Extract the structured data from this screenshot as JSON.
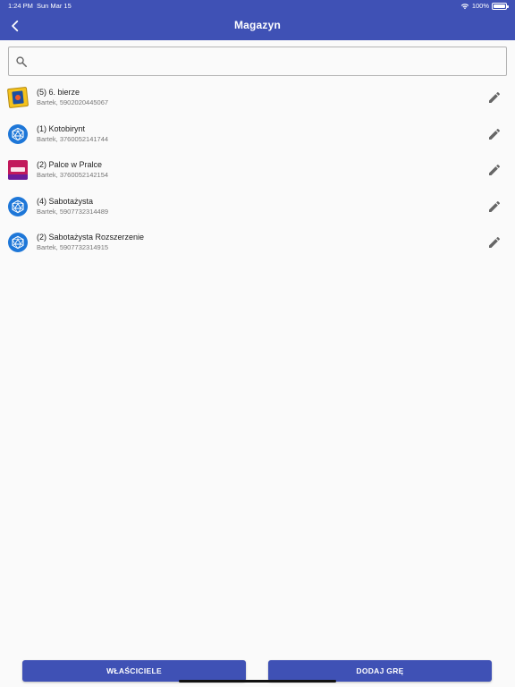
{
  "status_bar": {
    "time": "1:24 PM",
    "date": "Sun Mar 15",
    "battery": "100%",
    "battery_level": 1.0
  },
  "header": {
    "title": "Magazyn",
    "back_icon": "chevron-left-icon"
  },
  "search": {
    "value": "",
    "placeholder": "",
    "icon": "search-icon"
  },
  "games": [
    {
      "title": "(5) 6. bierze",
      "subtitle": "Bartek, 5902020445067",
      "thumb": "game-box-yellow"
    },
    {
      "title": "(1) Kotobirynt",
      "subtitle": "Bartek, 3760052141744",
      "thumb": "d20-dice-icon"
    },
    {
      "title": "(2) Palce w Pralce",
      "subtitle": "Bartek, 3760052142154",
      "thumb": "game-box-pink"
    },
    {
      "title": "(4) Sabotażysta",
      "subtitle": "Bartek, 5907732314489",
      "thumb": "d20-dice-icon"
    },
    {
      "title": "(2) Sabotażysta Rozszerzenie",
      "subtitle": "Bartek, 5907732314915",
      "thumb": "d20-dice-icon"
    }
  ],
  "buttons": {
    "owners": "WŁAŚCICIELE",
    "add_game": "DODAJ GRĘ"
  },
  "colors": {
    "primary": "#3f51b5",
    "dice": "#1e77d8",
    "background": "#fafafa"
  }
}
